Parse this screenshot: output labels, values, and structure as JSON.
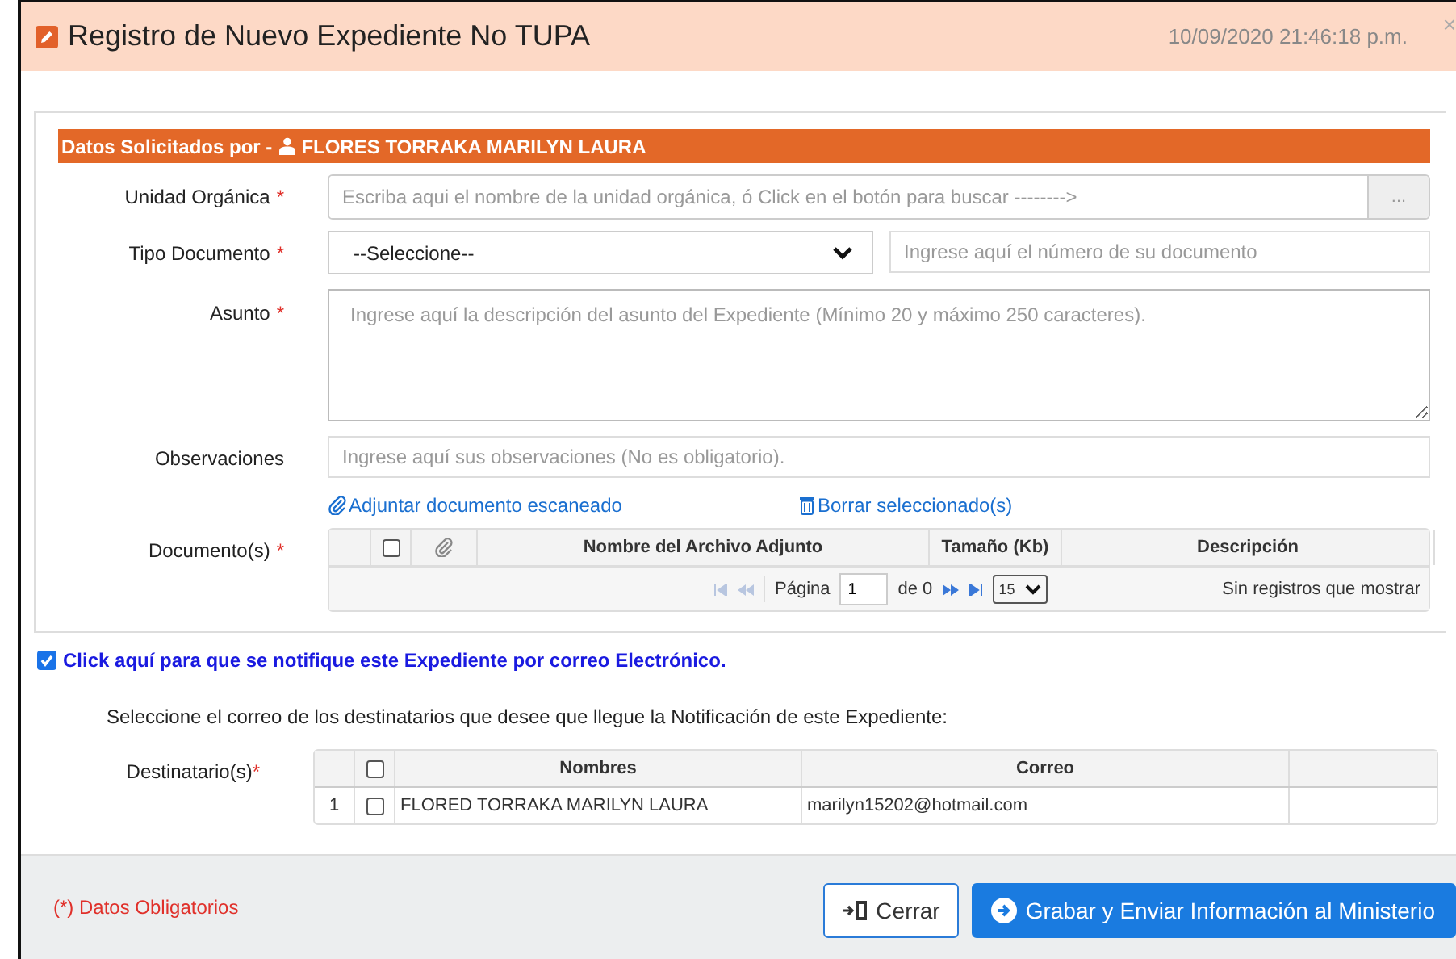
{
  "window": {
    "title": "Registro de Nuevo Expediente No TUPA",
    "datetime": "10/09/2020 21:46:18 p.m.",
    "close": "×"
  },
  "section": {
    "label": "Datos Solicitados por -",
    "person": "FLORES TORRAKA MARILYN LAURA"
  },
  "fields": [
    {
      "kind": "lookup",
      "label": "Unidad Orgánica",
      "required_mark": "*",
      "placeholder": "Escriba aqui el nombre de la unidad orgánica, ó Click en el botón para buscar -------->",
      "button": "..."
    },
    {
      "kind": "select",
      "label": "Tipo Documento",
      "required_mark": "*",
      "value": "--Seleccione--",
      "placeholder": "Ingrese aquí el número de su documento"
    },
    {
      "kind": "textarea",
      "label": "Asunto",
      "required_mark": "*",
      "placeholder": "Ingrese aquí la descripción del asunto del Expediente (Mínimo 20 y máximo 250 caracteres)."
    },
    {
      "kind": "text",
      "label": "Observaciones",
      "placeholder": "Ingrese aquí sus observaciones (No es obligatorio)."
    }
  ],
  "attachments": {
    "attach_link": "Adjuntar documento escaneado",
    "delete_link": "Borrar seleccionado(s)",
    "label": "Documento(s)",
    "required_mark": "*",
    "header_checked": false,
    "columns": [
      "Nombre del Archivo Adjunto",
      "Tamaño (Kb)",
      "Descripción"
    ],
    "pager": {
      "page_label": "Página",
      "page": "1",
      "of": "de 0",
      "page_size": "15",
      "empty": "Sin registros que mostrar"
    }
  },
  "notify": {
    "checked": true,
    "label": "Click aquí para que se notifique este Expediente por correo Electrónico."
  },
  "recipients": {
    "instruction": "Seleccione el correo de los destinatarios que desee que llegue la Notificación de este Expediente:",
    "label": "Destinatario(s)",
    "required_mark": "*",
    "header_checked": false,
    "columns": [
      "Nombres",
      "Correo"
    ],
    "rows": [
      {
        "index": "1",
        "checked": false,
        "name": "FLORED TORRAKA MARILYN LAURA",
        "email": "marilyn15202@hotmail.com"
      }
    ]
  },
  "footer": {
    "note": "(*) Datos Obligatorios",
    "buttons": [
      {
        "kind": "close",
        "label": "Cerrar"
      },
      {
        "kind": "primary",
        "label": "Grabar y Enviar Información al Ministerio"
      }
    ]
  }
}
